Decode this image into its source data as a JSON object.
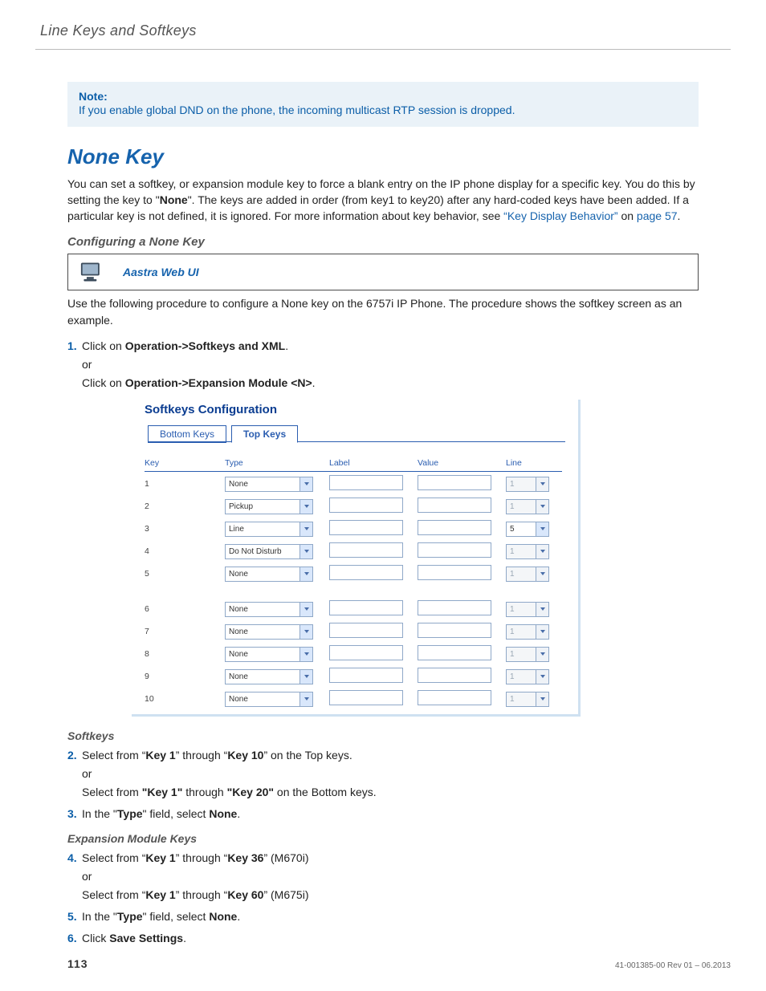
{
  "running_head": "Line Keys and Softkeys",
  "note": {
    "title": "Note:",
    "body": "If you enable global DND on the phone, the incoming multicast RTP session is dropped."
  },
  "h2": "None Key",
  "intro": {
    "pre": "You can set a softkey, or expansion module key to force a blank entry on the IP phone display for a specific key. You do this by setting the key to \"",
    "bold1": "None",
    "mid": "\". The keys are added in order (from key1 to key20) after any hard-coded keys have been added. If a particular key is not defined, it is ignored. For more information about key behavior, see ",
    "link1": "“Key Display Behavior”",
    "mid2": " on ",
    "link2": "page 57",
    "end": "."
  },
  "h3_configuring": "Configuring a None Key",
  "webui_label": "Aastra Web UI",
  "use_proc": "Use the following procedure to configure a None key on the 6757i IP Phone. The procedure shows the softkey screen as an example.",
  "steps": {
    "s1": {
      "num": "1.",
      "p1a": "Click on ",
      "p1b": "Operation->Softkeys and XML",
      "p1c": ".",
      "or": "or",
      "p2a": "Click on ",
      "p2b": "Operation->Expansion Module <N>",
      "p2c": "."
    },
    "softkeys_h": "Softkeys",
    "s2": {
      "num": "2.",
      "p1a": "Select from “",
      "p1b": "Key 1",
      "p1c": "” through “",
      "p1d": "Key 10",
      "p1e": "” on the Top keys.",
      "or": "or",
      "p2a": "Select from ",
      "p2b": "\"Key 1\"",
      "p2c": " through ",
      "p2d": "\"Key 20\"",
      "p2e": " on the Bottom keys."
    },
    "s3": {
      "num": "3.",
      "a": "In the \"",
      "b": "Type",
      "c": "\" field, select ",
      "d": "None",
      "e": "."
    },
    "exp_h": "Expansion Module Keys",
    "s4": {
      "num": "4.",
      "p1a": "Select from “",
      "p1b": "Key 1",
      "p1c": "” through “",
      "p1d": "Key 36",
      "p1e": "” (M670i)",
      "or": "or",
      "p2a": "Select from “",
      "p2b": "Key 1",
      "p2c": "” through “",
      "p2d": "Key 60",
      "p2e": "” (M675i)"
    },
    "s5": {
      "num": "5.",
      "a": "In the \"",
      "b": "Type",
      "c": "\" field, select ",
      "d": "None",
      "e": "."
    },
    "s6": {
      "num": "6.",
      "a": "Click ",
      "b": "Save Settings",
      "c": "."
    }
  },
  "ui": {
    "title": "Softkeys Configuration",
    "tab_bottom": "Bottom Keys",
    "tab_top": "Top Keys",
    "cols": {
      "key": "Key",
      "type": "Type",
      "label": "Label",
      "value": "Value",
      "line": "Line"
    },
    "rows": [
      {
        "key": "1",
        "type": "None",
        "line": "1",
        "line_disabled": true,
        "gap_before": false
      },
      {
        "key": "2",
        "type": "Pickup",
        "line": "1",
        "line_disabled": true,
        "gap_before": false
      },
      {
        "key": "3",
        "type": "Line",
        "line": "5",
        "line_disabled": false,
        "gap_before": false
      },
      {
        "key": "4",
        "type": "Do Not Disturb",
        "line": "1",
        "line_disabled": true,
        "gap_before": false
      },
      {
        "key": "5",
        "type": "None",
        "line": "1",
        "line_disabled": true,
        "gap_before": false
      },
      {
        "key": "6",
        "type": "None",
        "line": "1",
        "line_disabled": true,
        "gap_before": true
      },
      {
        "key": "7",
        "type": "None",
        "line": "1",
        "line_disabled": true,
        "gap_before": false
      },
      {
        "key": "8",
        "type": "None",
        "line": "1",
        "line_disabled": true,
        "gap_before": false
      },
      {
        "key": "9",
        "type": "None",
        "line": "1",
        "line_disabled": true,
        "gap_before": false
      },
      {
        "key": "10",
        "type": "None",
        "line": "1",
        "line_disabled": true,
        "gap_before": false
      }
    ]
  },
  "footer": {
    "page": "113",
    "rev": "41-001385-00 Rev 01 – 06.2013"
  }
}
